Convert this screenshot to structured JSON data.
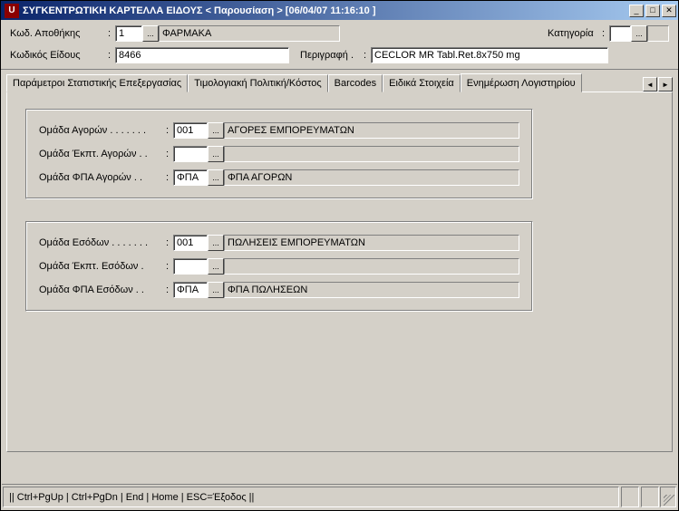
{
  "window": {
    "title": "ΣΥΓΚΕΝΤΡΩΤΙΚΗ ΚΑΡΤΕΛΛΑ ΕΙΔΟΥΣ < Παρουσίαση >   [06/04/07 11:16:10  ]"
  },
  "header": {
    "warehouse_label": "Κωδ. Αποθήκης",
    "warehouse_code": "1",
    "warehouse_desc": "ΦΑΡΜΑΚΑ",
    "category_label": "Κατηγορία",
    "category_code": "",
    "category_desc": "",
    "itemcode_label": "Κωδικός Είδους",
    "itemcode": "8466",
    "desc_label": "Περιγραφή .",
    "desc": "CECLOR MR Tabl.Ret.8x750 mg"
  },
  "tabs": {
    "t0": "Παράμετροι Στατιστικής Επεξεργασίας",
    "t1": "Τιμολογιακή Πολιτική/Κόστος",
    "t2": "Barcodes",
    "t3": "Ειδικά Στοιχεία",
    "t4": "Ενημέρωση Λογιστηρίου"
  },
  "purchase": {
    "group_label": "Ομάδα Αγορών . . . . . . .",
    "group_code": "001",
    "group_desc": "ΑΓΟΡΕΣ ΕΜΠΟΡΕΥΜΑΤΩΝ",
    "discount_label": "Ομάδα Έκπτ. Αγορών . .",
    "discount_code": "",
    "discount_desc": "",
    "vat_label": "Ομάδα ΦΠΑ Αγορών . .",
    "vat_code": "ΦΠΑ",
    "vat_desc": "ΦΠΑ ΑΓΟΡΩΝ"
  },
  "sales": {
    "group_label": "Ομάδα Εσόδων . . . . . . .",
    "group_code": "001",
    "group_desc": "ΠΩΛΗΣΕΙΣ ΕΜΠΟΡΕΥΜΑΤΩΝ",
    "discount_label": "Ομάδα Έκπτ. Εσόδων .",
    "discount_code": "",
    "discount_desc": "",
    "vat_label": "Ομάδα ΦΠΑ Εσόδων . .",
    "vat_code": "ΦΠΑ",
    "vat_desc": "ΦΠΑ ΠΩΛΗΣΕΩΝ"
  },
  "statusbar": {
    "hints": " || Ctrl+PgUp | Ctrl+PgDn | End | Home | ESC=Έξοδος ||"
  },
  "glyphs": {
    "ellipsis": "...",
    "left": "◄",
    "right": "►",
    "min": "_",
    "max": "□",
    "close": "✕"
  }
}
